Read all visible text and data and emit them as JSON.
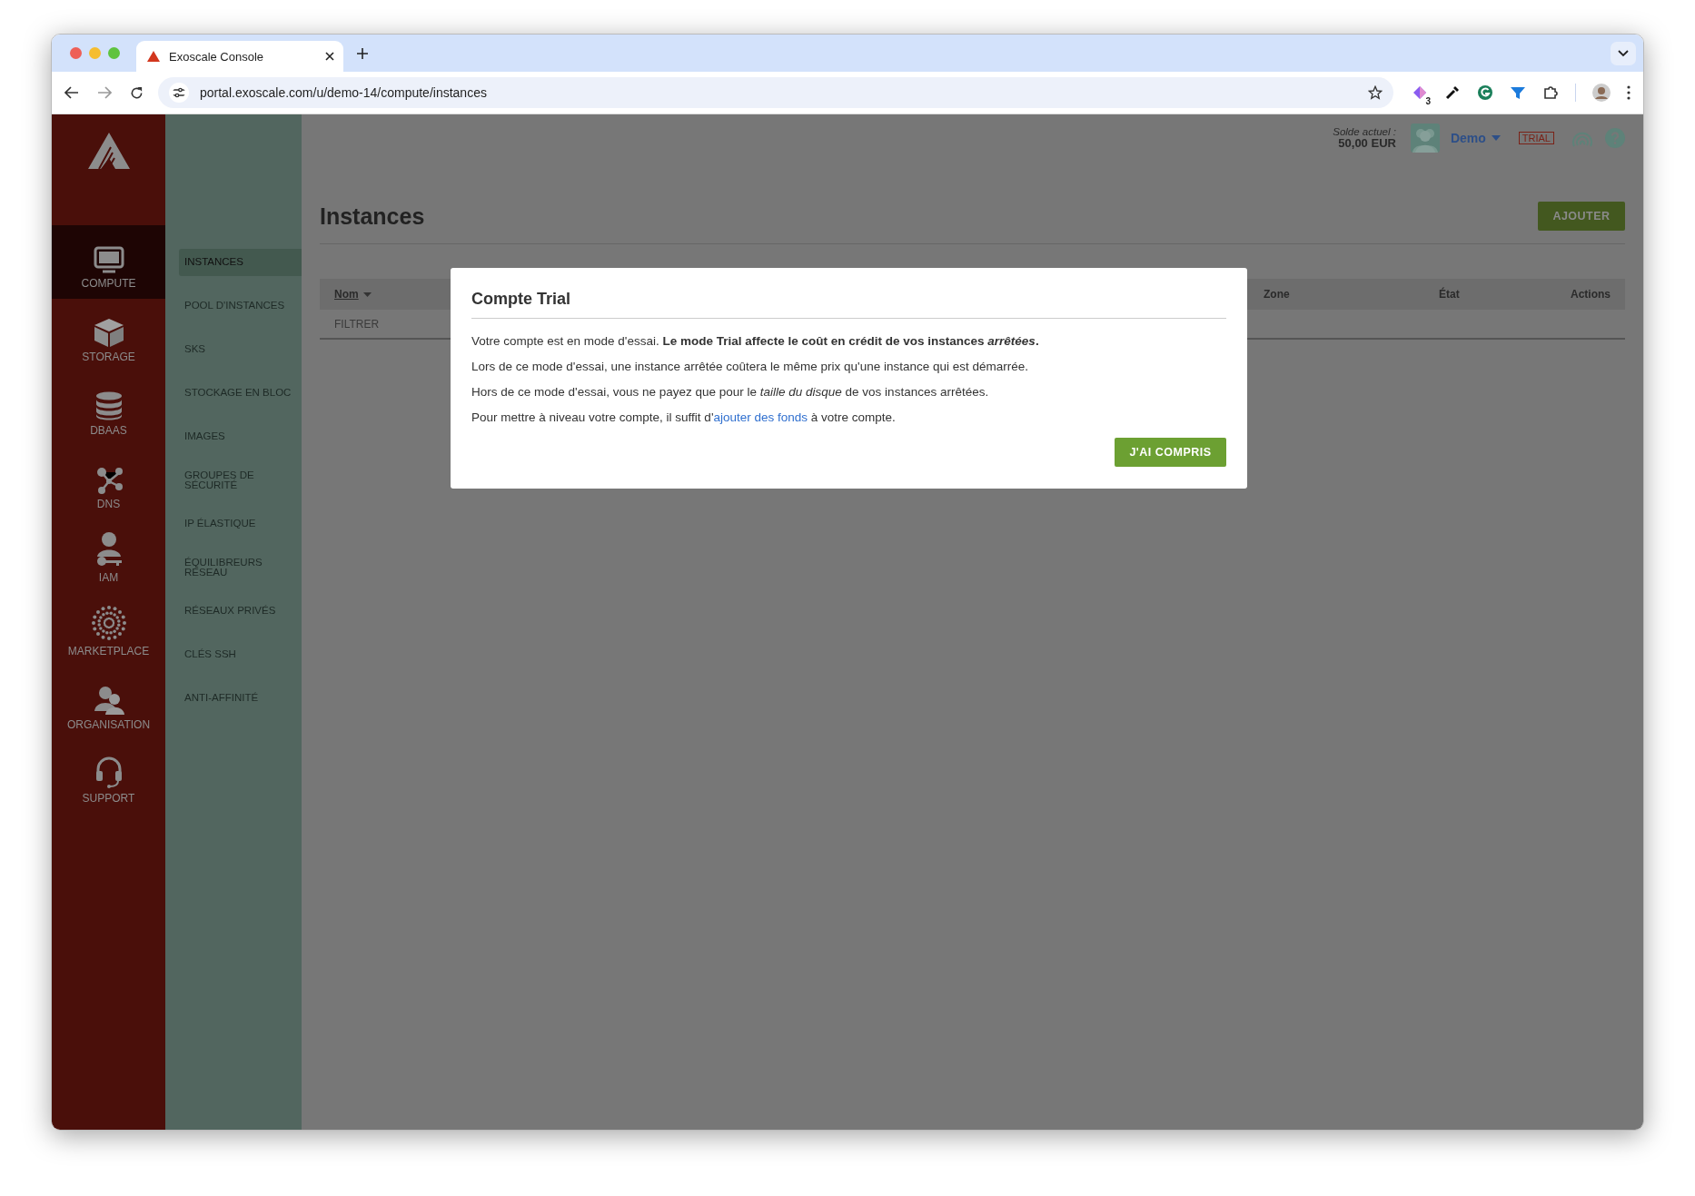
{
  "browser": {
    "tabs": [
      {
        "title": "Exoscale Console",
        "selected": true
      }
    ],
    "url": "portal.exoscale.com/u/demo-14/compute/instances",
    "extension_badge": "3"
  },
  "rail": [
    {
      "label": "COMPUTE",
      "selected": true
    },
    {
      "label": "STORAGE",
      "selected": false
    },
    {
      "label": "DBAAS",
      "selected": false
    },
    {
      "label": "DNS",
      "selected": false
    },
    {
      "label": "IAM",
      "selected": false
    },
    {
      "label": "MARKETPLACE",
      "selected": false
    },
    {
      "label": "ORGANISATION",
      "selected": false
    },
    {
      "label": "SUPPORT",
      "selected": false
    }
  ],
  "subnav": [
    {
      "label": "INSTANCES",
      "selected": true
    },
    {
      "label": "POOL D'INSTANCES",
      "selected": false
    },
    {
      "label": "SKS",
      "selected": false
    },
    {
      "label": "STOCKAGE EN BLOC",
      "selected": false
    },
    {
      "label": "IMAGES",
      "selected": false
    },
    {
      "label": "GROUPES DE SÉCURITÉ",
      "selected": false
    },
    {
      "label": "IP ÉLASTIQUE",
      "selected": false
    },
    {
      "label": "ÉQUILIBREURS RÉSEAU",
      "selected": false
    },
    {
      "label": "RÉSEAUX PRIVÉS",
      "selected": false
    },
    {
      "label": "CLÉS SSH",
      "selected": false
    },
    {
      "label": "ANTI-AFFINITÉ",
      "selected": false
    }
  ],
  "header": {
    "balance_label": "Solde actuel :",
    "balance": "50,00 EUR",
    "user": "Demo",
    "badge": "TRIAL"
  },
  "page": {
    "title": "Instances",
    "add_button": "AJOUTER",
    "columns": [
      {
        "label": "Nom",
        "sorted": true
      },
      {
        "label": "Zone",
        "sorted": false
      },
      {
        "label": "État",
        "sorted": false
      },
      {
        "label": "Actions",
        "sorted": false
      }
    ],
    "filter": {
      "placeholder": "FILTRER"
    }
  },
  "modal": {
    "title": "Compte Trial",
    "paragraphs": [
      "Votre compte est en mode d'essai. **Le mode Trial affecte le coût en crédit de vos instances *arrêtées*.**",
      "Lors de ce mode d'essai, une instance arrêtée coûtera le même prix qu'une instance qui est démarrée.",
      "Hors de ce mode d'essai, vous ne payez que pour le *taille du disque* de vos instances arrêtées."
    ],
    "link_paragraph": {
      "before": "Pour mettre à niveau votre compte, il suffit d'",
      "link": "ajouter des fonds",
      "after": " à votre compte."
    },
    "button": "J'AI COMPRIS"
  }
}
